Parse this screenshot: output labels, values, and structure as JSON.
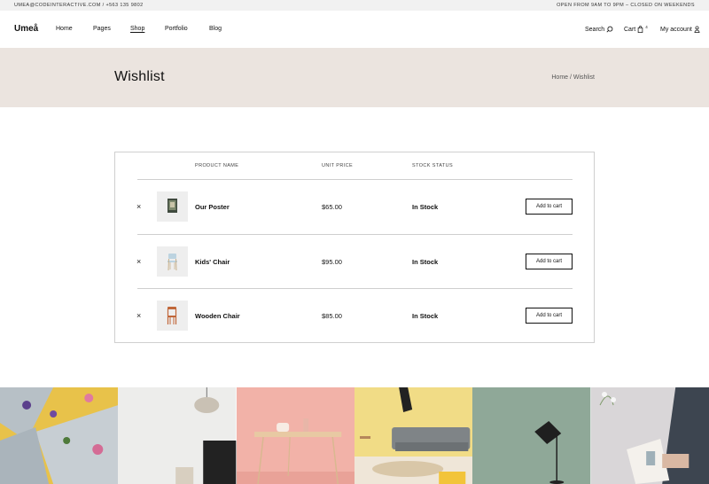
{
  "topbar": {
    "contact": "UMEA@CODEINTERACTIVE.COM / +563 135 9802",
    "hours": "OPEN FROM 9AM TO 9PM – CLOSED ON WEEKENDS"
  },
  "header": {
    "logo": "Umeå",
    "nav": [
      "Home",
      "Pages",
      "Shop",
      "Portfolio",
      "Blog"
    ],
    "active_nav": "Shop",
    "search_label": "Search",
    "cart_label": "Cart",
    "cart_count": "4",
    "account_label": "My account"
  },
  "banner": {
    "title": "Wishlist",
    "breadcrumb": "Home / Wishlist"
  },
  "wishlist": {
    "columns": [
      "PRODUCT NAME",
      "UNIT PRICE",
      "STOCK STATUS"
    ],
    "remove_symbol": "×",
    "items": [
      {
        "name": "Our Poster",
        "price": "$65.00",
        "stock": "In Stock",
        "button": "Add to cart",
        "icon": "poster-icon"
      },
      {
        "name": "Kids' Chair",
        "price": "$95.00",
        "stock": "In Stock",
        "button": "Add to cart",
        "icon": "kids-chair-icon"
      },
      {
        "name": "Wooden Chair",
        "price": "$85.00",
        "stock": "In Stock",
        "button": "Add to cart",
        "icon": "wooden-chair-icon"
      }
    ]
  },
  "gallery": [
    "flowers-cards-photo",
    "pendant-lamp-photo",
    "pink-table-photo",
    "sofa-jump-photo",
    "floor-lamp-photo",
    "magazine-photo"
  ],
  "colors": {
    "banner": "#ebe4df",
    "topbar": "#f1f1f1",
    "border": "#cfcfcf"
  }
}
